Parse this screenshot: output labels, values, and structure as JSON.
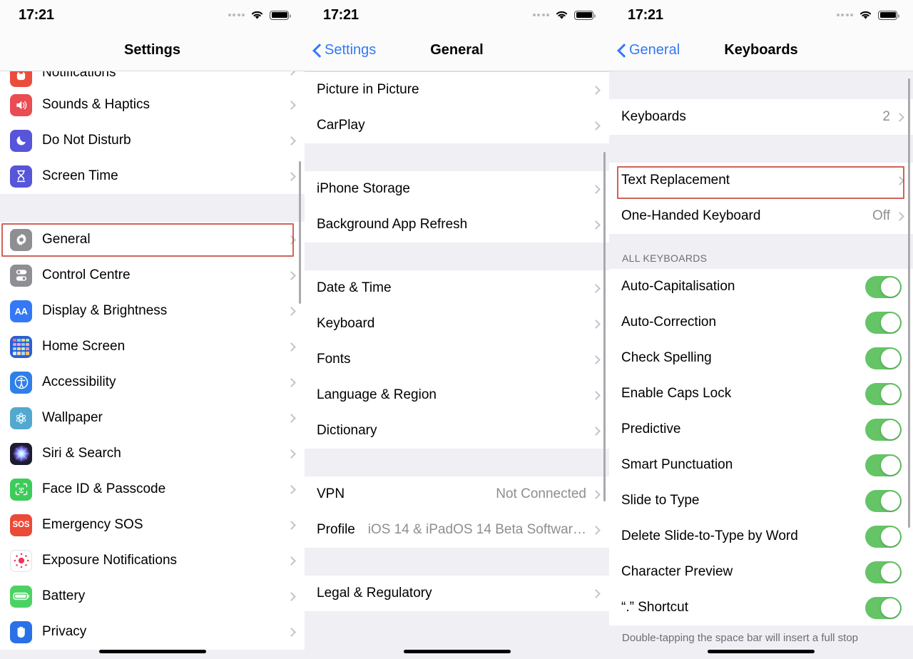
{
  "status": {
    "time": "17:21",
    "signal_icon": "cellular-dots-icon",
    "wifi_icon": "wifi-icon",
    "battery_icon": "battery-icon"
  },
  "panels": {
    "settings": {
      "title": "Settings",
      "groups": [
        {
          "rows": [
            {
              "label": "Notifications",
              "icon": "notifications-icon",
              "color": "#eb4d3d",
              "chevron": true,
              "partial": true
            },
            {
              "label": "Sounds & Haptics",
              "icon": "sounds-haptics-icon",
              "color": "#ea4c54",
              "chevron": true
            },
            {
              "label": "Do Not Disturb",
              "icon": "do-not-disturb-icon",
              "color": "#5755d9",
              "chevron": true
            },
            {
              "label": "Screen Time",
              "icon": "screen-time-icon",
              "color": "#5755d9",
              "chevron": true
            }
          ]
        },
        {
          "rows": [
            {
              "label": "General",
              "icon": "general-gear-icon",
              "color": "#8e8e93",
              "chevron": true,
              "highlighted": true
            },
            {
              "label": "Control Centre",
              "icon": "control-centre-icon",
              "color": "#8e8e93",
              "chevron": true
            },
            {
              "label": "Display & Brightness",
              "icon": "display-brightness-icon",
              "color": "#3478f6",
              "chevron": true
            },
            {
              "label": "Home Screen",
              "icon": "home-screen-icon",
              "color": "#2c5fd4",
              "chevron": true
            },
            {
              "label": "Accessibility",
              "icon": "accessibility-icon",
              "color": "#2f7fe8",
              "chevron": true
            },
            {
              "label": "Wallpaper",
              "icon": "wallpaper-icon",
              "color": "#53a8d0",
              "chevron": true
            },
            {
              "label": "Siri & Search",
              "icon": "siri-search-icon",
              "color": "#1c1c2e",
              "chevron": true
            },
            {
              "label": "Face ID & Passcode",
              "icon": "face-id-icon",
              "color": "#3fcb5a",
              "chevron": true
            },
            {
              "label": "Emergency SOS",
              "icon": "emergency-sos-icon",
              "color": "#ea4a37",
              "chevron": true
            },
            {
              "label": "Exposure Notifications",
              "icon": "exposure-notifications-icon",
              "color": "#ffffff",
              "chevron": true
            },
            {
              "label": "Battery",
              "icon": "battery-settings-icon",
              "color": "#4cd264",
              "chevron": true
            },
            {
              "label": "Privacy",
              "icon": "privacy-hand-icon",
              "color": "#2a71e8",
              "chevron": true
            }
          ]
        }
      ]
    },
    "general": {
      "title": "General",
      "back_label": "Settings",
      "groups": [
        {
          "rows": [
            {
              "label": "Picture in Picture",
              "chevron": true
            },
            {
              "label": "CarPlay",
              "chevron": true
            }
          ]
        },
        {
          "rows": [
            {
              "label": "iPhone Storage",
              "chevron": true
            },
            {
              "label": "Background App Refresh",
              "chevron": true
            }
          ]
        },
        {
          "rows": [
            {
              "label": "Date & Time",
              "chevron": true
            },
            {
              "label": "Keyboard",
              "chevron": true,
              "highlighted": true
            },
            {
              "label": "Fonts",
              "chevron": true
            },
            {
              "label": "Language & Region",
              "chevron": true
            },
            {
              "label": "Dictionary",
              "chevron": true
            }
          ]
        },
        {
          "rows": [
            {
              "label": "VPN",
              "value": "Not Connected",
              "chevron": true
            },
            {
              "label": "Profile",
              "value": "iOS 14 & iPadOS 14 Beta Softwar…",
              "chevron": true
            }
          ]
        },
        {
          "rows": [
            {
              "label": "Legal & Regulatory",
              "chevron": true
            }
          ]
        }
      ]
    },
    "keyboards": {
      "title": "Keyboards",
      "back_label": "General",
      "groups": [
        {
          "rows": [
            {
              "label": "Keyboards",
              "value": "2",
              "chevron": true
            }
          ]
        },
        {
          "rows": [
            {
              "label": "Text Replacement",
              "chevron": true,
              "highlighted": true
            },
            {
              "label": "One-Handed Keyboard",
              "value": "Off",
              "chevron": true
            }
          ]
        },
        {
          "header": "ALL KEYBOARDS",
          "rows": [
            {
              "label": "Auto-Capitalisation",
              "toggle": true,
              "on": true
            },
            {
              "label": "Auto-Correction",
              "toggle": true,
              "on": true
            },
            {
              "label": "Check Spelling",
              "toggle": true,
              "on": true
            },
            {
              "label": "Enable Caps Lock",
              "toggle": true,
              "on": true
            },
            {
              "label": "Predictive",
              "toggle": true,
              "on": true
            },
            {
              "label": "Smart Punctuation",
              "toggle": true,
              "on": true
            },
            {
              "label": "Slide to Type",
              "toggle": true,
              "on": true
            },
            {
              "label": "Delete Slide-to-Type by Word",
              "toggle": true,
              "on": true
            },
            {
              "label": "Character Preview",
              "toggle": true,
              "on": true
            },
            {
              "label": "“.” Shortcut",
              "toggle": true,
              "on": true
            }
          ],
          "footer": "Double-tapping the space bar will insert a full stop"
        }
      ]
    }
  },
  "colors": {
    "highlight": "#c0392b",
    "accent": "#3478f6",
    "toggle_on": "#65c466",
    "group_bg": "#efeff4",
    "separator": "#dddde1"
  }
}
